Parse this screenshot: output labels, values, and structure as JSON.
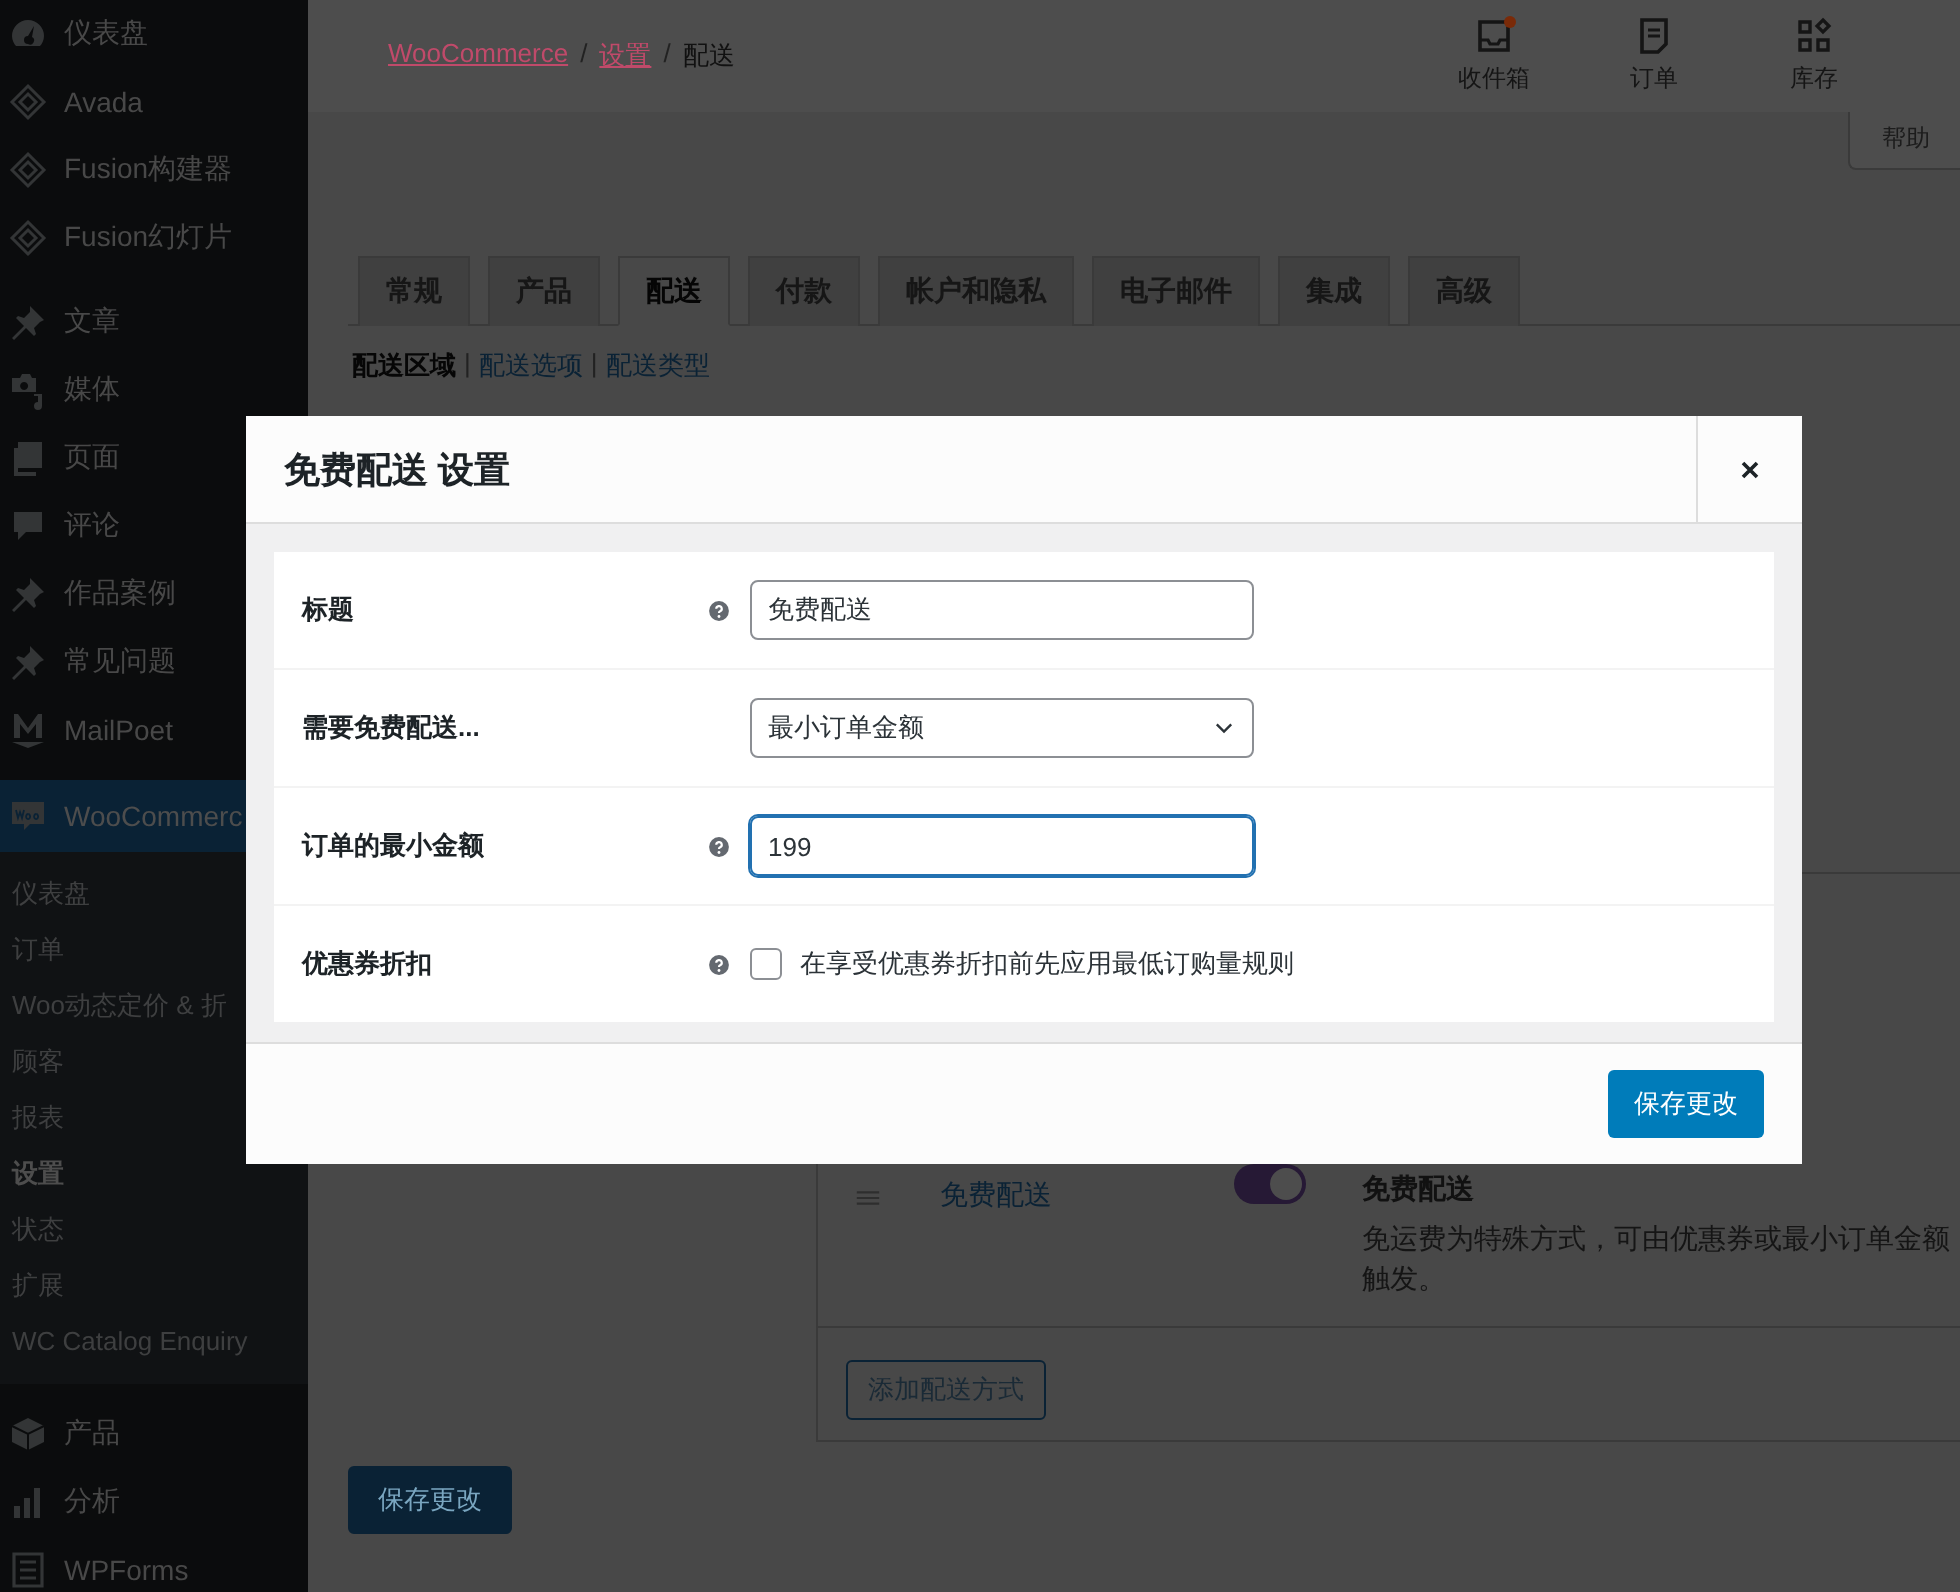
{
  "sidebar": {
    "groups": [
      [
        {
          "label": "仪表盘",
          "selected": false
        },
        {
          "label": "Avada",
          "selected": false
        },
        {
          "label": "Fusion构建器",
          "selected": false
        },
        {
          "label": "Fusion幻灯片",
          "selected": false
        }
      ],
      [
        {
          "label": "文章",
          "selected": false
        },
        {
          "label": "媒体",
          "selected": false
        },
        {
          "label": "页面",
          "selected": false
        },
        {
          "label": "评论",
          "selected": false
        },
        {
          "label": "作品案例",
          "selected": false
        },
        {
          "label": "常见问题",
          "selected": false
        },
        {
          "label": "MailPoet",
          "selected": false
        }
      ],
      [
        {
          "label": "WooCommerc",
          "selected": true,
          "children": [
            {
              "label": "仪表盘",
              "selected": false
            },
            {
              "label": "订单",
              "selected": false
            },
            {
              "label": "Woo动态定价 & 折",
              "selected": false
            },
            {
              "label": "顾客",
              "selected": false
            },
            {
              "label": "报表",
              "selected": false
            },
            {
              "label": "设置",
              "selected": true
            },
            {
              "label": "状态",
              "selected": false
            },
            {
              "label": "扩展",
              "selected": false
            },
            {
              "label": "WC Catalog Enquiry",
              "selected": false
            }
          ]
        }
      ],
      [
        {
          "label": "产品",
          "selected": false
        },
        {
          "label": "分析",
          "selected": false
        },
        {
          "label": "WPForms",
          "selected": false
        }
      ]
    ]
  },
  "header": {
    "breadcrumb": [
      {
        "text": "WooCommerce",
        "kind": "link"
      },
      {
        "text": "/",
        "kind": "sep"
      },
      {
        "text": "设置",
        "kind": "link"
      },
      {
        "text": "/",
        "kind": "sep"
      },
      {
        "text": "配送",
        "kind": "current"
      }
    ],
    "activity": [
      {
        "label": "收件箱",
        "unread": true
      },
      {
        "label": "订单",
        "unread": false
      },
      {
        "label": "库存",
        "unread": false
      }
    ],
    "help": "帮助"
  },
  "tabs": [
    {
      "label": "常规",
      "selected": false
    },
    {
      "label": "产品",
      "selected": false
    },
    {
      "label": "配送",
      "selected": true
    },
    {
      "label": "付款",
      "selected": false
    },
    {
      "label": "帐户和隐私",
      "selected": false
    },
    {
      "label": "电子邮件",
      "selected": false
    },
    {
      "label": "集成",
      "selected": false
    },
    {
      "label": "高级",
      "selected": false
    }
  ],
  "subnav": [
    {
      "label": "配送区域",
      "selected": true
    },
    {
      "separator_before": "|",
      "label": "配送选项",
      "selected": false
    },
    {
      "separator_before": "|",
      "label": "配送类型",
      "selected": false
    }
  ],
  "methods": {
    "rows": [
      {
        "name": "免费配送",
        "enabled": true,
        "title": "免费配送",
        "description": "免运费为特殊方式，可由优惠券或最小订单金额触发。"
      }
    ],
    "add_button": "添加配送方式"
  },
  "save_button": "保存更改",
  "modal": {
    "title": "免费配送 设置",
    "fields": [
      {
        "kind": "text",
        "label": "标题",
        "help": true,
        "value": "免费配送",
        "focused": false
      },
      {
        "kind": "select",
        "label": "需要免费配送...",
        "help": false,
        "value": "最小订单金额"
      },
      {
        "kind": "text",
        "label": "订单的最小金额",
        "help": true,
        "value": "199",
        "focused": true
      },
      {
        "kind": "checkbox",
        "label": "优惠券折扣",
        "help": true,
        "checked": false,
        "text": "在享受优惠券折扣前先应用最低订购量规则"
      }
    ],
    "save_button": "保存更改"
  }
}
